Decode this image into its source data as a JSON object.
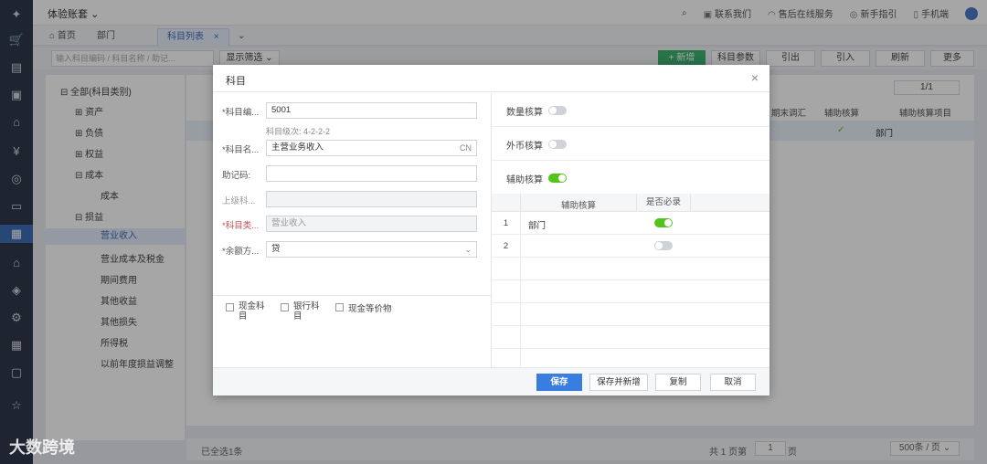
{
  "app": {
    "account_name": "体验账套",
    "header_links": [
      "联系我们",
      "售后在线服务",
      "新手指引",
      "手机端"
    ]
  },
  "tabs": [
    {
      "label": "首页"
    },
    {
      "label": "部门"
    },
    {
      "label": "科目列表"
    }
  ],
  "toolbar": {
    "search_placeholder": "输入科目编码 / 科目名称 / 助记...",
    "filter_label": "显示筛选",
    "buttons": [
      "+ 新增",
      "科目参数",
      "引出",
      "引入",
      "刷新",
      "更多"
    ]
  },
  "tree": {
    "items": [
      {
        "label": "全部(科目类别)"
      },
      {
        "label": "资产"
      },
      {
        "label": "负债"
      },
      {
        "label": "权益"
      },
      {
        "label": "成本"
      },
      {
        "label": "成本"
      },
      {
        "label": "损益"
      },
      {
        "label": "营业收入"
      },
      {
        "label": "营业成本及税金"
      },
      {
        "label": "期间费用"
      },
      {
        "label": "其他收益"
      },
      {
        "label": "其他损失"
      },
      {
        "label": "所得税"
      },
      {
        "label": "以前年度损益调整"
      }
    ]
  },
  "grid": {
    "headers": [
      "期末调汇",
      "辅助核算",
      "辅助核算项目"
    ],
    "row_value": "部门",
    "pager": "1/1",
    "footer_selected": "已全选1条",
    "footer_total": "共 1 页第",
    "footer_page": "1",
    "footer_page_suffix": "页",
    "footer_size": "500条 / 页"
  },
  "dialog": {
    "title": "科目",
    "fields": {
      "code_label": "*科目编...",
      "code_value": "5001",
      "level_hint": "科目级次: 4-2-2-2",
      "name_label": "*科目名...",
      "name_value": "主营业务收入",
      "name_suffix": "CN",
      "mnemonic_label": "助记码:",
      "mnemonic_value": "",
      "parent_label": "上级科...",
      "parent_value": "",
      "category_label": "*科目类...",
      "category_value": "营业收入",
      "balance_label": "*余额方...",
      "balance_value": "贷"
    },
    "checkboxes": [
      "现金科目",
      "银行科目",
      "现金等价物"
    ],
    "toggles": [
      {
        "label": "数量核算",
        "on": false
      },
      {
        "label": "外币核算",
        "on": false
      },
      {
        "label": "辅助核算",
        "on": true
      }
    ],
    "subtable": {
      "col_item": "辅助核算",
      "col_required": "是否必录",
      "rows": [
        {
          "num": "1",
          "item": "部门",
          "required": true
        },
        {
          "num": "2",
          "item": "",
          "required": false
        }
      ]
    },
    "buttons": {
      "save": "保存",
      "save_new": "保存并新增",
      "copy": "复制",
      "cancel": "取消"
    }
  },
  "watermark": "大数跨境"
}
